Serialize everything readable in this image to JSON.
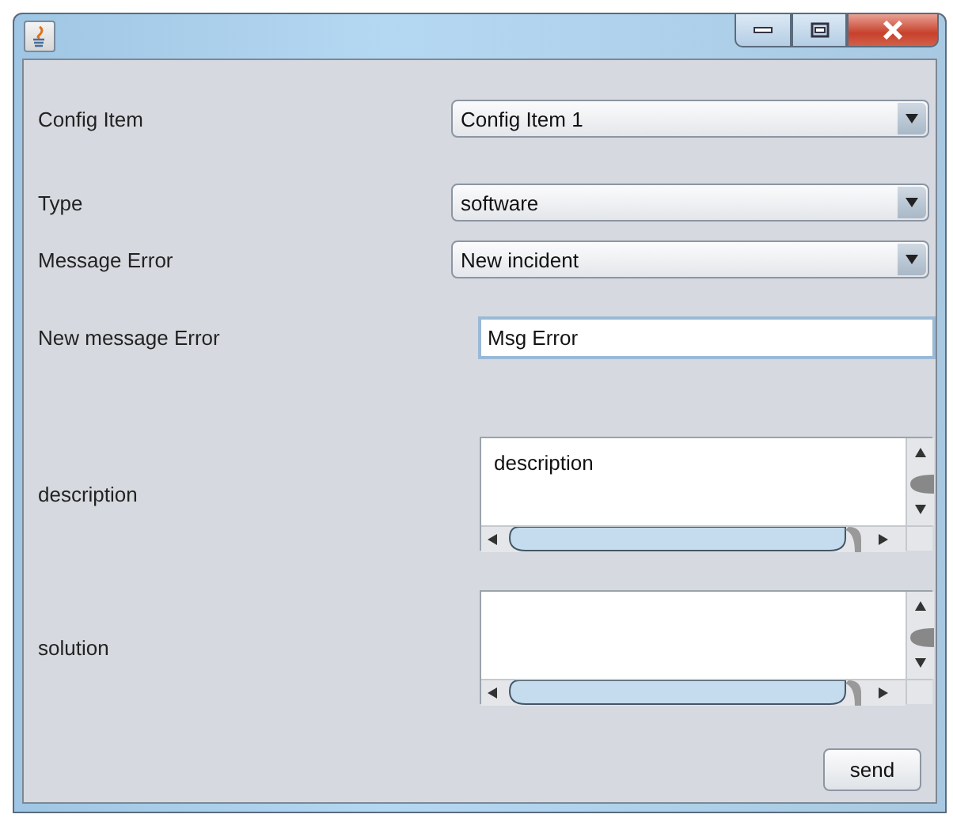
{
  "fields": [
    {
      "kind": "combo",
      "label": "Config Item",
      "value": "Config Item 1"
    },
    {
      "kind": "combo",
      "label": "Type",
      "value": "software"
    },
    {
      "kind": "combo",
      "label": "Message Error",
      "value": "New incident"
    },
    {
      "kind": "text",
      "label": "New message Error",
      "value": "Msg Error",
      "focused": true
    },
    {
      "kind": "textarea",
      "label": "description",
      "value": "description"
    },
    {
      "kind": "textarea",
      "label": "solution"
    }
  ],
  "buttons": [
    {
      "label": "send"
    }
  ]
}
